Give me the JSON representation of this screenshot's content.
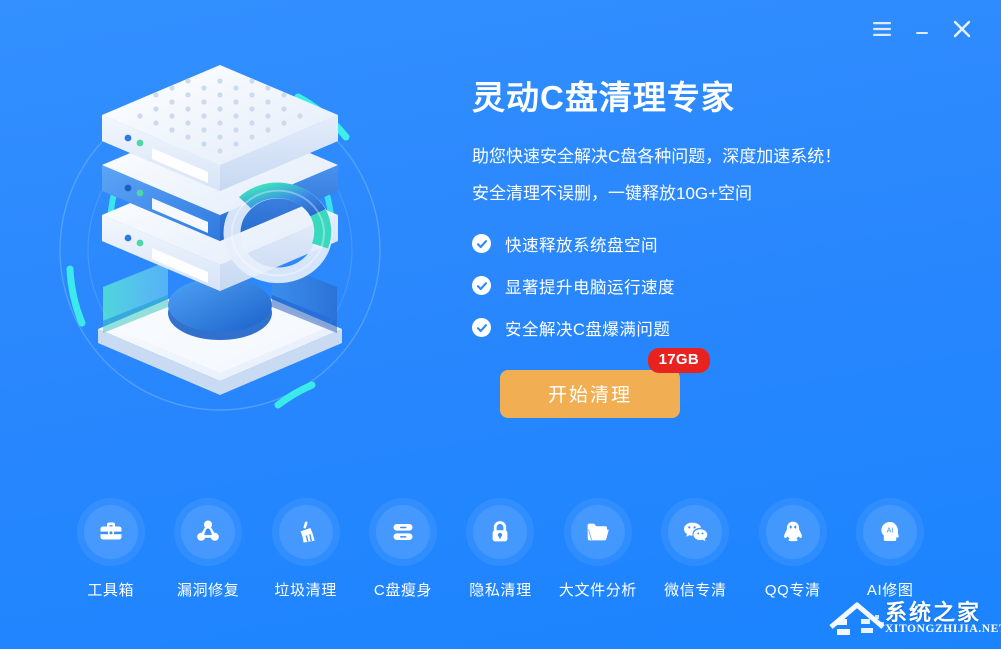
{
  "window": {
    "menu_icon": "hamburger-menu-icon",
    "minimize_icon": "minimize-icon",
    "close_icon": "close-icon"
  },
  "hero": {
    "headline": "灵动C盘清理专家",
    "subline_1": "助您快速安全解决C盘各种问题，深度加速系统！",
    "subline_2": "安全清理不误删，一键释放10G+空间",
    "features": [
      {
        "label": "快速释放系统盘空间",
        "icon": "check-circle-icon"
      },
      {
        "label": "显著提升电脑运行速度",
        "icon": "check-circle-icon"
      },
      {
        "label": "安全解决C盘爆满问题",
        "icon": "check-circle-icon"
      }
    ],
    "cta": {
      "label": "开始清理",
      "badge": "17GB",
      "button_color": "#F2AE52",
      "badge_color": "#E8231F"
    }
  },
  "illustration": {
    "name": "server-stack-3d-illustration",
    "accent_cyan": "#3DF5E8",
    "accent_blue": "#2E88FD"
  },
  "tools": [
    {
      "label": "工具箱",
      "icon": "toolbox-icon"
    },
    {
      "label": "漏洞修复",
      "icon": "vulnerability-repair-icon"
    },
    {
      "label": "垃圾清理",
      "icon": "broom-icon"
    },
    {
      "label": "C盘瘦身",
      "icon": "disk-slim-icon"
    },
    {
      "label": "隐私清理",
      "icon": "lock-icon"
    },
    {
      "label": "大文件分析",
      "icon": "folder-icon"
    },
    {
      "label": "微信专清",
      "icon": "wechat-icon"
    },
    {
      "label": "QQ专清",
      "icon": "qq-penguin-icon"
    },
    {
      "label": "AI修图",
      "icon": "ai-head-icon"
    }
  ],
  "watermark": {
    "title": "系统之家",
    "domain": "XITONGZHIJIA.NET",
    "logo_icon": "house-logo-icon"
  },
  "theme": {
    "background": "#2E88FD",
    "text": "#FFFFFF"
  }
}
